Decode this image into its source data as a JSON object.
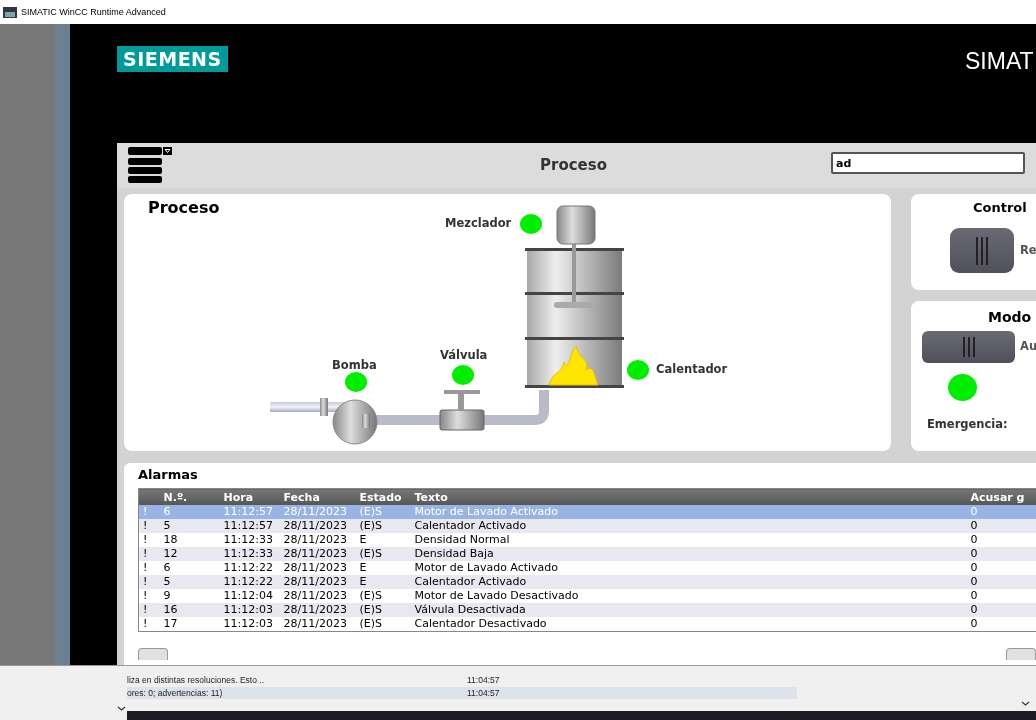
{
  "window": {
    "title": "SIMATIC WinCC Runtime Advanced"
  },
  "header": {
    "logo": "SIEMENS",
    "product": "SIMAT"
  },
  "screen": {
    "title": "Proceso",
    "field_value": "ad"
  },
  "process": {
    "title": "Proceso",
    "indicators": [
      {
        "label": "Mezclador",
        "on": true
      },
      {
        "label": "Bomba",
        "on": true
      },
      {
        "label": "Válvula",
        "on": true
      },
      {
        "label": "Calentador",
        "on": true
      }
    ]
  },
  "control": {
    "title": "Control",
    "switch_label": "Re",
    "switch_on": false
  },
  "mode": {
    "title": "Modo",
    "switch_label": "Au",
    "switch_on": false,
    "indicator_on": true,
    "emergency_label": "Emergencia:"
  },
  "alarms": {
    "title": "Alarmas",
    "columns": [
      "N.º.",
      "Hora",
      "Fecha",
      "Estado",
      "Texto",
      "Acusar g"
    ],
    "rows": [
      {
        "mark": "!",
        "no": "6",
        "time": "11:12:57",
        "date": "28/11/2023",
        "state": "(E)S",
        "text": "Motor de Lavado Activado",
        "ack": "0",
        "selected": true
      },
      {
        "mark": "!",
        "no": "5",
        "time": "11:12:57",
        "date": "28/11/2023",
        "state": "(E)S",
        "text": "Calentador Activado",
        "ack": "0",
        "selected": false
      },
      {
        "mark": "!",
        "no": "18",
        "time": "11:12:33",
        "date": "28/11/2023",
        "state": "E",
        "text": "Densidad Normal",
        "ack": "0",
        "selected": false
      },
      {
        "mark": "!",
        "no": "12",
        "time": "11:12:33",
        "date": "28/11/2023",
        "state": "(E)S",
        "text": "Densidad Baja",
        "ack": "0",
        "selected": false
      },
      {
        "mark": "!",
        "no": "6",
        "time": "11:12:22",
        "date": "28/11/2023",
        "state": "E",
        "text": "Motor de Lavado Activado",
        "ack": "0",
        "selected": false
      },
      {
        "mark": "!",
        "no": "5",
        "time": "11:12:22",
        "date": "28/11/2023",
        "state": "E",
        "text": "Calentador Activado",
        "ack": "0",
        "selected": false
      },
      {
        "mark": "!",
        "no": "9",
        "time": "11:12:04",
        "date": "28/11/2023",
        "state": "(E)S",
        "text": "Motor de Lavado Desactivado",
        "ack": "0",
        "selected": false
      },
      {
        "mark": "!",
        "no": "16",
        "time": "11:12:03",
        "date": "28/11/2023",
        "state": "(E)S",
        "text": "Válvula Desactivada",
        "ack": "0",
        "selected": false
      },
      {
        "mark": "!",
        "no": "17",
        "time": "11:12:03",
        "date": "28/11/2023",
        "state": "(E)S",
        "text": "Calentador Desactivado",
        "ack": "0",
        "selected": false
      }
    ]
  },
  "background_log": {
    "rows": [
      {
        "message": "liza en distintas resoluciones. Esto ..",
        "time": "11:04:57"
      },
      {
        "message": "ores: 0; advertencias: 11)",
        "time": "11:04:57"
      }
    ]
  }
}
